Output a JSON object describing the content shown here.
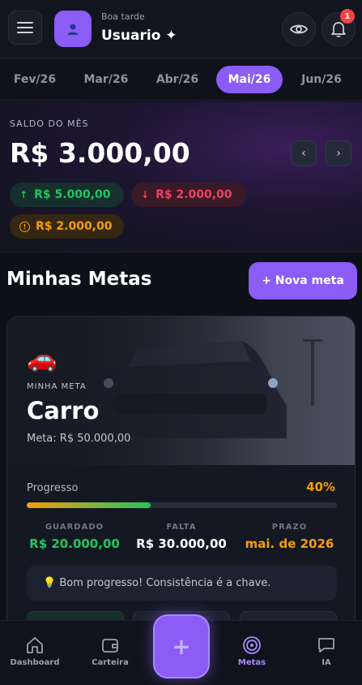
{
  "header": {
    "greeting": "Boa tarde",
    "username": "Usuario ✦",
    "notification_count": "1",
    "icons": [
      "menu-icon",
      "user-icon",
      "eye-icon",
      "bell-icon"
    ]
  },
  "months": {
    "tabs": [
      {
        "label": "Fev/26",
        "active": false
      },
      {
        "label": "Mar/26",
        "active": false
      },
      {
        "label": "Abr/26",
        "active": false
      },
      {
        "label": "Mai/26",
        "active": true
      },
      {
        "label": "Jun/26",
        "active": false
      }
    ]
  },
  "balance": {
    "label": "SALDO DO MÊS",
    "value": "R$ 3.000,00",
    "prev_arrow": "‹",
    "next_arrow": "›",
    "income": {
      "arrow": "↑",
      "value": "R$ 5.000,00",
      "color": "#22c55e"
    },
    "expense": {
      "arrow": "↓",
      "value": "R$ 2.000,00",
      "color": "#f43f5e"
    },
    "pending": {
      "icon": "!",
      "value": "R$ 2.000,00",
      "color": "#f59e0b"
    }
  },
  "goals": {
    "title": "Minhas Metas",
    "new_button": "+ Nova meta",
    "card": {
      "emoji": "🚗",
      "kicker": "MINHA META",
      "name": "Carro",
      "target": "Meta: R$ 50.000,00",
      "progress_label": "Progresso",
      "progress_pct": "40%",
      "progress_value": 0.4,
      "saved_label": "GUARDADO",
      "saved_value": "R$ 20.000,00",
      "remaining_label": "FALTA",
      "remaining_value": "R$ 30.000,00",
      "deadline_label": "PRAZO",
      "deadline_value": "mai. de 2026",
      "tip": "💡 Bom progresso! Consistência é a chave."
    }
  },
  "bottom_nav": {
    "items": [
      {
        "label": "Dashboard",
        "icon": "home-icon",
        "active": false
      },
      {
        "label": "Carteira",
        "icon": "wallet-icon",
        "active": false
      },
      {
        "label": "Metas",
        "icon": "target-icon",
        "active": true
      },
      {
        "label": "IA",
        "icon": "chat-icon",
        "active": false
      }
    ],
    "fab": "+"
  },
  "colors": {
    "accent": "#8b5cf6",
    "income": "#22c55e",
    "expense": "#f43f5e",
    "warning": "#f59e0b",
    "background": "#0d1017"
  }
}
